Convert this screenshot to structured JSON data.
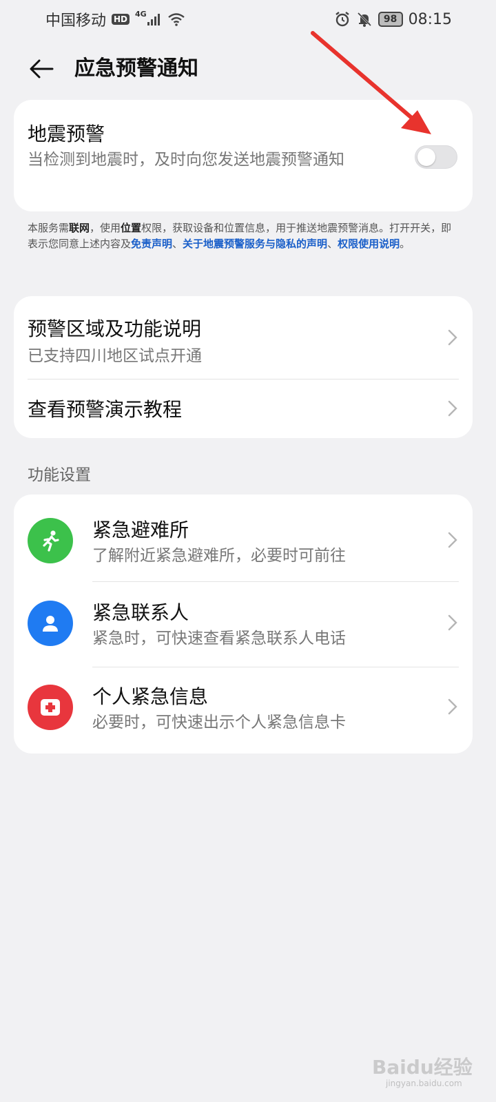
{
  "status_bar": {
    "carrier": "中国移动",
    "hd": "HD",
    "network": "4G",
    "battery": "98",
    "time": "08:15"
  },
  "header": {
    "title": "应急预警通知"
  },
  "earthquake": {
    "title": "地震预警",
    "subtitle": "当检测到地震时，及时向您发送地震预警通知",
    "toggle_on": false
  },
  "disclaimer": {
    "t1": "本服务需",
    "b1": "联网",
    "t2": "，使用",
    "b2": "位置",
    "t3": "权限，获取设备和位置信息，用于推送地震预警消息。打开开关，即表示您同意上述内容及",
    "l1": "免责声明",
    "t4": "、",
    "l2": "关于地震预警服务与隐私的声明",
    "t5": "、",
    "l3": "权限使用说明",
    "t6": "。"
  },
  "info": {
    "row1_title": "预警区域及功能说明",
    "row1_sub": "已支持四川地区试点开通",
    "row2_title": "查看预警演示教程"
  },
  "section_label": "功能设置",
  "functions": [
    {
      "title": "紧急避难所",
      "subtitle": "了解附近紧急避难所，必要时可前往",
      "color": "#3cc14b"
    },
    {
      "title": "紧急联系人",
      "subtitle": "紧急时，可快速查看紧急联系人电话",
      "color": "#1f7bf2"
    },
    {
      "title": "个人紧急信息",
      "subtitle": "必要时，可快速出示个人紧急信息卡",
      "color": "#e8363d"
    }
  ],
  "watermark": {
    "text": "Baidu经验",
    "sub": "jingyan.baidu.com"
  }
}
